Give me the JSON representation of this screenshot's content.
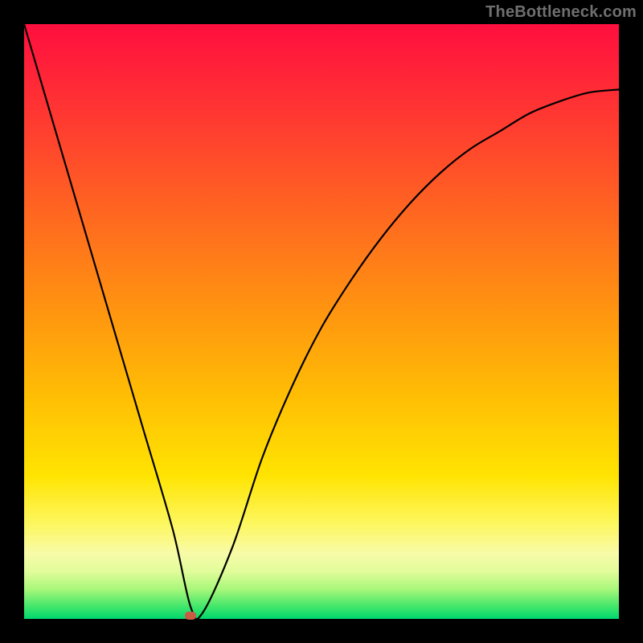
{
  "watermark": "TheBottleneck.com",
  "chart_data": {
    "type": "line",
    "title": "",
    "xlabel": "",
    "ylabel": "",
    "xlim": [
      0,
      100
    ],
    "ylim": [
      0,
      100
    ],
    "grid": false,
    "legend": false,
    "series": [
      {
        "name": "curve",
        "x": [
          0,
          5,
          10,
          15,
          20,
          25,
          28,
          30,
          35,
          40,
          45,
          50,
          55,
          60,
          65,
          70,
          75,
          80,
          85,
          90,
          95,
          100
        ],
        "y": [
          100,
          83,
          66,
          49,
          32,
          15,
          2,
          1,
          12,
          27,
          39,
          49,
          57,
          64,
          70,
          75,
          79,
          82,
          85,
          87,
          88.5,
          89
        ]
      }
    ],
    "marker": {
      "x": 28,
      "y": 0.5
    },
    "background_gradient": {
      "direction": "vertical",
      "stops": [
        {
          "pos": 0,
          "color": "#ff0f3e"
        },
        {
          "pos": 18,
          "color": "#ff3f2f"
        },
        {
          "pos": 48,
          "color": "#ff9410"
        },
        {
          "pos": 76,
          "color": "#ffe402"
        },
        {
          "pos": 92,
          "color": "#e2fc9b"
        },
        {
          "pos": 100,
          "color": "#00d86f"
        }
      ]
    }
  }
}
